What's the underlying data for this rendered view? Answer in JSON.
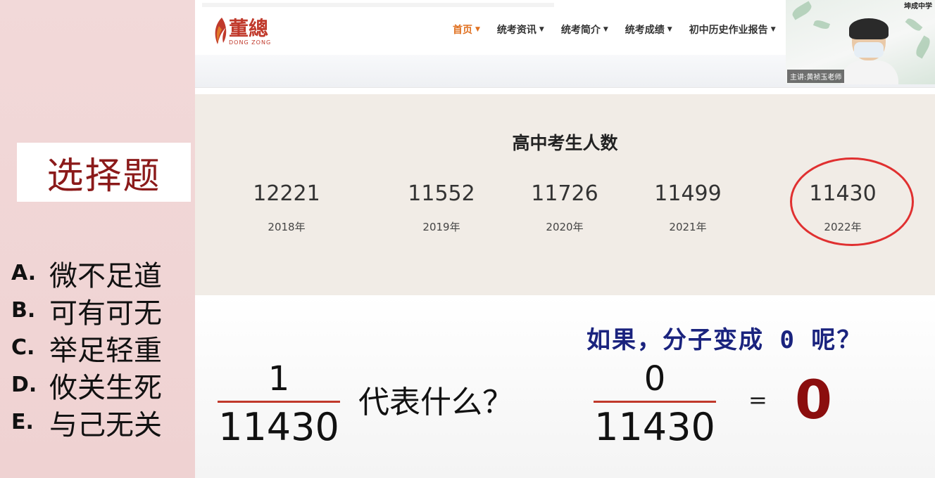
{
  "quiz": {
    "title": "选择题",
    "options": [
      {
        "letter": "A.",
        "text": "微不足道"
      },
      {
        "letter": "B.",
        "text": "可有可无"
      },
      {
        "letter": "C.",
        "text": "举足轻重"
      },
      {
        "letter": "D.",
        "text": "攸关生死"
      },
      {
        "letter": "E.",
        "text": "与己无关"
      }
    ]
  },
  "site": {
    "logo_cn": "董總",
    "logo_en": "DONG ZONG",
    "nav": [
      {
        "label": "首页"
      },
      {
        "label": "统考资讯"
      },
      {
        "label": "统考简介"
      },
      {
        "label": "统考成绩"
      },
      {
        "label": "初中历史作业报告"
      }
    ],
    "stats": {
      "title": "高中考生人数",
      "items": [
        {
          "value": "12221",
          "year": "2018年"
        },
        {
          "value": "11552",
          "year": "2019年"
        },
        {
          "value": "11726",
          "year": "2020年"
        },
        {
          "value": "11499",
          "year": "2021年"
        },
        {
          "value": "11430",
          "year": "2022年"
        }
      ]
    }
  },
  "webcam": {
    "speaker": "主讲:黄祯玉老师",
    "school": "坤成中学"
  },
  "lesson": {
    "question_hint": "如果，分子变成 0 呢？",
    "fraction1": {
      "numerator": "1",
      "denominator": "11430"
    },
    "represents": "代表什么？",
    "fraction2": {
      "numerator": "0",
      "denominator": "11430"
    },
    "equals": "=",
    "result": "0"
  },
  "colors": {
    "accent_red": "#c0392b",
    "nav_active": "#e07020",
    "circle": "#e03030",
    "hint_blue": "#1a237e"
  }
}
